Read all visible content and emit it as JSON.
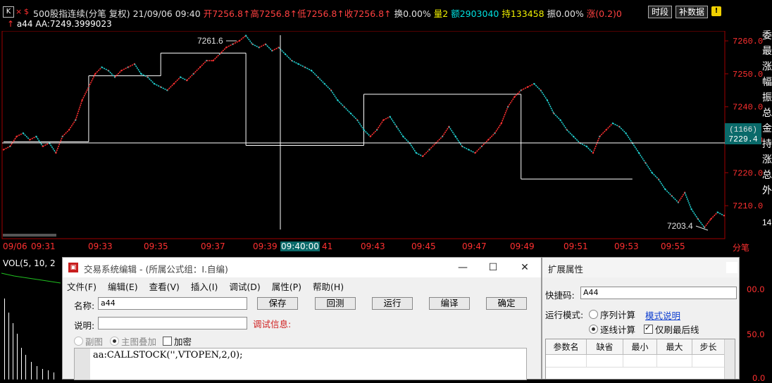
{
  "header": {
    "k_label": "K",
    "close_glyph": "×",
    "dollar_glyph": "$",
    "title": "500股指连续(分笔 复权)",
    "datetime": "21/09/06 09:40",
    "open": "开7256.8↑",
    "high": "高7256.8↑",
    "low": "低7256.8↑",
    "close": "收7256.8↑",
    "turnover": "换0.00%",
    "volume": "量2",
    "amount": "额2903040",
    "position": "持133458",
    "amplitude": "振0.00%",
    "change": "涨(0.2)0",
    "btn_timeframe": "时段",
    "btn_supplement": "补数据",
    "indicator_line": "a44 AA:7249.3999023"
  },
  "chart_data": {
    "type": "line",
    "title": "",
    "ylim": [
      7200,
      7263
    ],
    "y_ticks": [
      "7260.0",
      "7250.0",
      "7240.0",
      "7230.0",
      "7220.0",
      "7210.0"
    ],
    "x_ticks": [
      "09/06",
      "09:31",
      "09:33",
      "09:35",
      "09:37",
      "09:39",
      "09:40:00",
      "41",
      "09:43",
      "09:45",
      "09:47",
      "09:49",
      "09:51",
      "09:53",
      "09:55",
      "分笔"
    ],
    "current_label": "(1166)",
    "current_price": "7229.4",
    "high_label": "7261.6",
    "low_label": "7203.4",
    "right_edge_label": "14",
    "series_price": [
      7227,
      7228,
      7231,
      7232,
      7230,
      7231,
      7228,
      7229,
      7226,
      7231,
      7233,
      7236,
      7242,
      7246,
      7250,
      7252,
      7251,
      7249,
      7251,
      7252,
      7253,
      7250,
      7249,
      7247,
      7246,
      7245,
      7247,
      7249,
      7248,
      7250,
      7252,
      7254,
      7254,
      7256,
      7258,
      7259,
      7260,
      7261.6,
      7259,
      7258,
      7259,
      7257,
      7258,
      7256,
      7254,
      7253,
      7252,
      7251,
      7249,
      7247,
      7245,
      7242,
      7240,
      7238,
      7236,
      7233,
      7231,
      7233,
      7236,
      7237,
      7234,
      7231,
      7229,
      7226,
      7225,
      7227,
      7229,
      7231,
      7234,
      7231,
      7228,
      7227,
      7226,
      7228,
      7230,
      7232,
      7235,
      7240,
      7243,
      7245,
      7246,
      7247,
      7245,
      7242,
      7238,
      7236,
      7233,
      7231,
      7229,
      7228,
      7226,
      7231,
      7233,
      7235,
      7234,
      7232,
      7229,
      7226,
      7223,
      7220,
      7218,
      7215,
      7213,
      7211,
      7214,
      7209,
      7206,
      7203.4,
      7206,
      7208,
      7207
    ],
    "series_aa": [
      {
        "from": 0,
        "to": 13,
        "value": 7229.4
      },
      {
        "from": 13,
        "to": 24,
        "value": 7249.4
      },
      {
        "from": 24,
        "to": 37,
        "value": 7256.3
      },
      {
        "from": 37,
        "to": 55,
        "value": 7228.3
      },
      {
        "from": 55,
        "to": 79,
        "value": 7243.8
      },
      {
        "from": 79,
        "to": 96,
        "value": 7218.1
      }
    ]
  },
  "vol_panel": {
    "label": "VOL(5, 10, 2",
    "right_ticks": [
      "00.0",
      "50.0",
      "0.0"
    ]
  },
  "right_strip": [
    "委",
    "最",
    "涨",
    "幅",
    "振",
    "总",
    "金",
    "持",
    "涨",
    "总",
    "外"
  ],
  "dialog": {
    "title": "交易系统编辑 - (所属公式组：I.自编)",
    "menus": [
      "文件(F)",
      "编辑(E)",
      "查看(V)",
      "插入(I)",
      "调试(D)",
      "属性(P)",
      "帮助(H)"
    ],
    "name_label": "名称:",
    "name_value": "a44",
    "desc_label": "说明:",
    "desc_value": "",
    "debug_label": "调试信息:",
    "buttons": [
      "保存",
      "回测",
      "运行",
      "编译",
      "确定"
    ],
    "opt_sub": "副图",
    "opt_main": "主图叠加",
    "opt_encrypt": "加密",
    "code": "aa:CALLSTOCK('',VTOPEN,2,0);",
    "win_min": "—",
    "win_max": "☐",
    "win_close": "✕"
  },
  "ext": {
    "title": "扩展属性",
    "shortcut_label": "快捷码:",
    "shortcut_value": "A44",
    "mode_label": "运行模式:",
    "mode_seq": "序列计算",
    "mode_tick": "逐线计算",
    "mode_link": "模式说明",
    "refresh_last": "仅刷最后线",
    "table_headers": [
      "参数名",
      "缺省",
      "最小",
      "最大",
      "步长"
    ]
  }
}
